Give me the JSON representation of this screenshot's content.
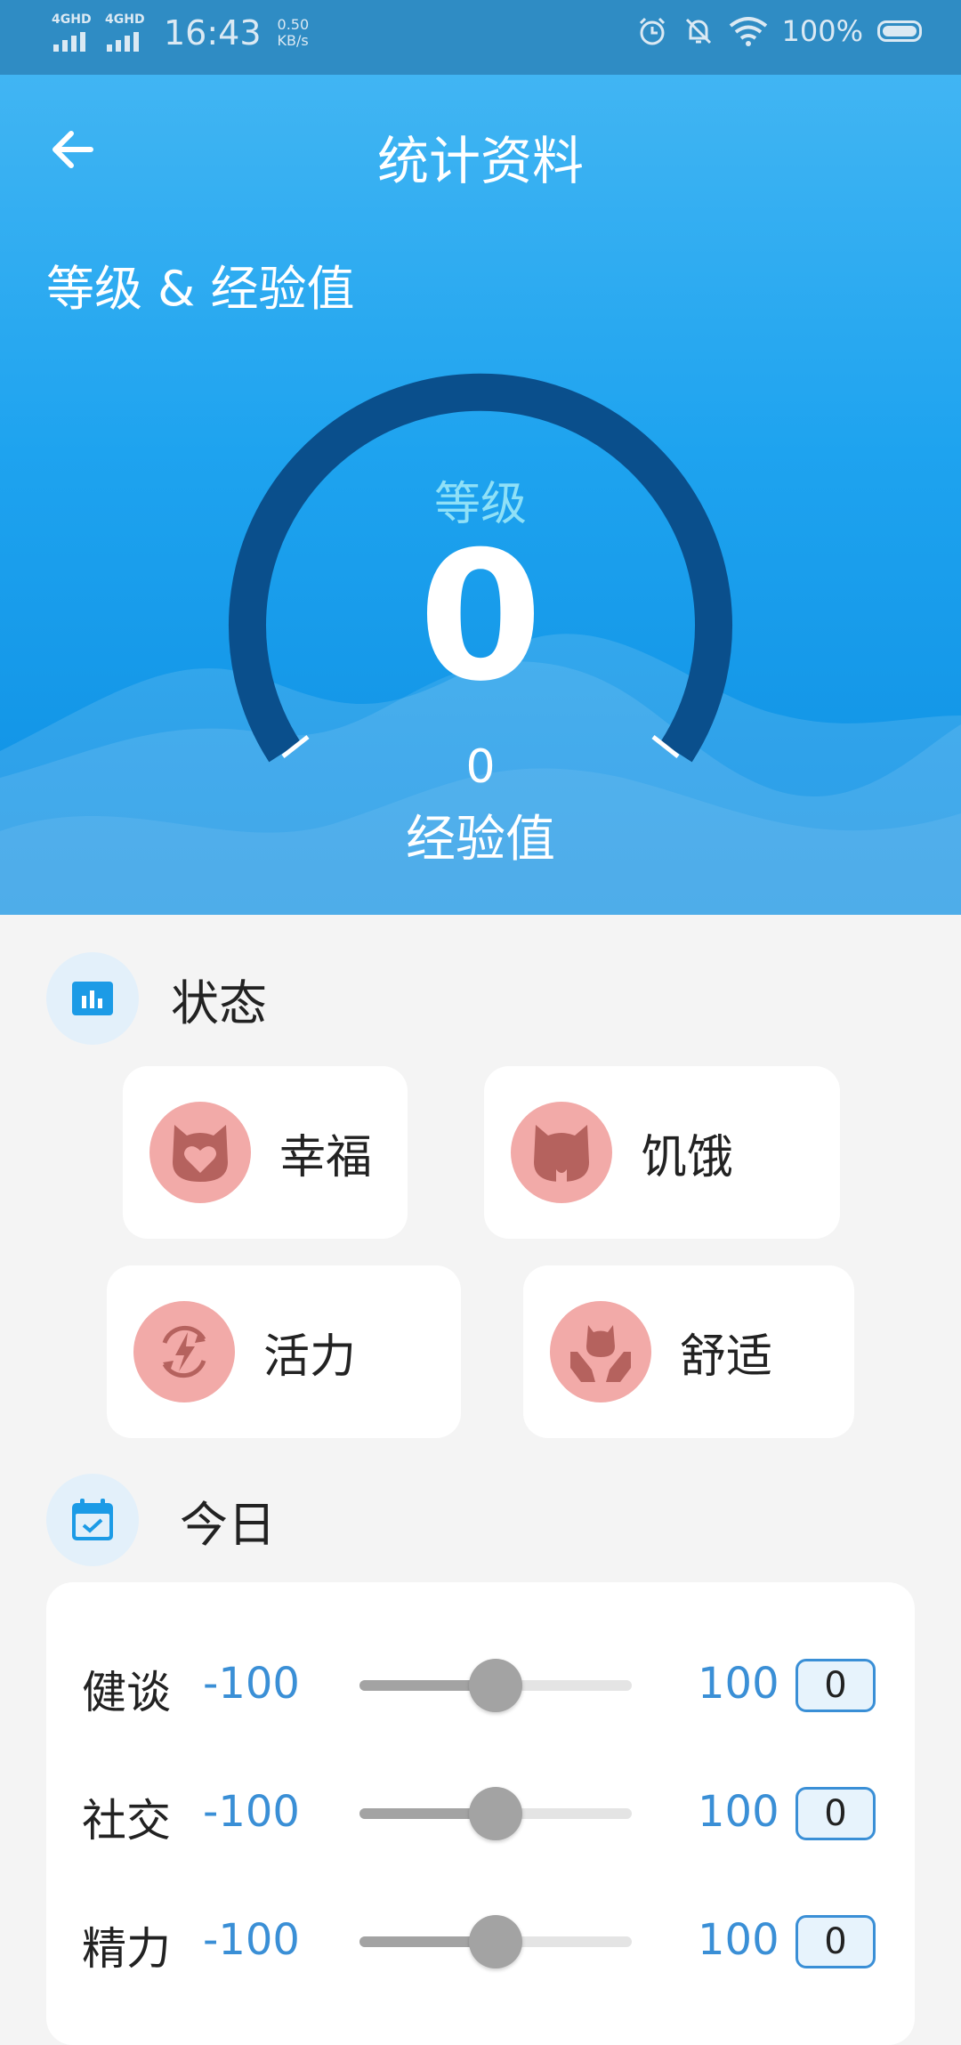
{
  "status_bar": {
    "network_1": "4GHD",
    "network_2": "4GHD",
    "time": "16:43",
    "speed_value": "0.50",
    "speed_unit": "KB/s",
    "battery": "100%"
  },
  "header": {
    "title": "统计资料"
  },
  "level_section": {
    "label": "等级 & 经验值",
    "level_label": "等级",
    "level_value": "0",
    "exp_value": "0",
    "exp_label": "经验值",
    "colors": {
      "arc": "#0a4f8c",
      "level_label": "#8fe0f7"
    }
  },
  "status_section": {
    "title": "状态",
    "items": [
      {
        "label": "幸福",
        "icon": "cat-heart-icon"
      },
      {
        "label": "饥饿",
        "icon": "cat-hungry-icon"
      },
      {
        "label": "活力",
        "icon": "energy-icon"
      },
      {
        "label": "舒适",
        "icon": "cat-hands-icon"
      }
    ]
  },
  "today_section": {
    "title": "今日",
    "rows": [
      {
        "name": "健谈",
        "min": "-100",
        "max": "100",
        "value": "0",
        "level": 0.5
      },
      {
        "name": "社交",
        "min": "-100",
        "max": "100",
        "value": "0",
        "level": 0.5
      },
      {
        "name": "精力",
        "min": "-100",
        "max": "100",
        "value": "0",
        "level": 0.5
      }
    ]
  }
}
